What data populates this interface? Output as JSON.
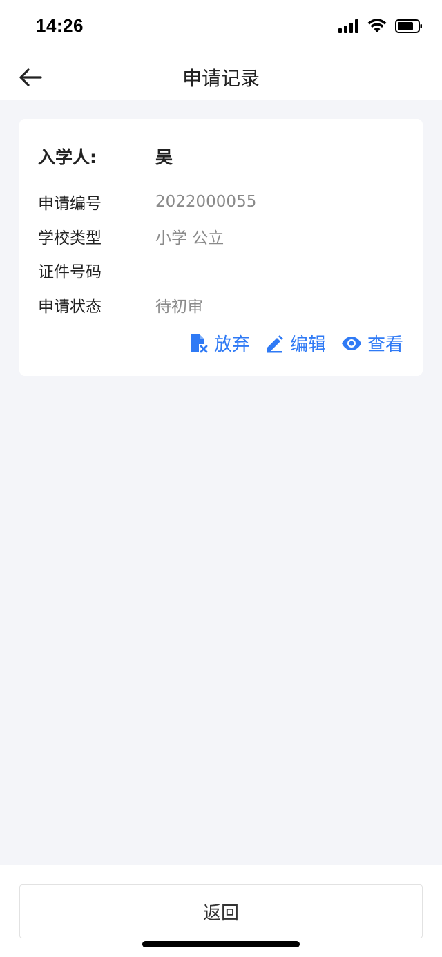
{
  "status_bar": {
    "time": "14:26"
  },
  "nav": {
    "title": "申请记录"
  },
  "record": {
    "student_label": "入学人:",
    "student_name": "吴",
    "app_no_label": "申请编号",
    "app_no": "2022000055",
    "school_type_label": "学校类型",
    "school_type": "小学 公立",
    "id_no_label": "证件号码",
    "id_no": "",
    "status_label": "申请状态",
    "status": "待初审"
  },
  "actions": {
    "abandon": "放弃",
    "edit": "编辑",
    "view": "查看"
  },
  "footer": {
    "return_label": "返回"
  },
  "colors": {
    "accent": "#2f7af5",
    "background": "#f4f5f9"
  }
}
